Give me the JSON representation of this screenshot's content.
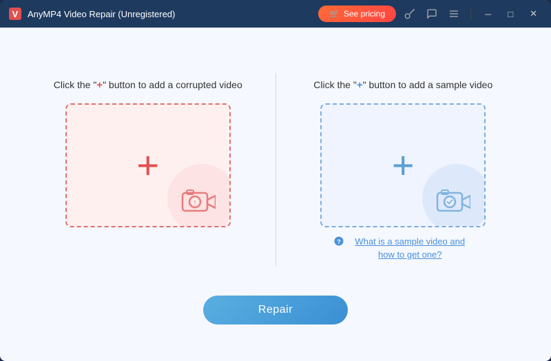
{
  "titlebar": {
    "logo_alt": "AnyMP4 logo",
    "title": "AnyMP4 Video Repair (Unregistered)",
    "see_pricing_label": "See pricing",
    "icon_key": "🛒",
    "window_controls": {
      "minimize": "─",
      "maximize": "□",
      "close": "✕"
    }
  },
  "left_panel": {
    "label_prefix": "Click the \"",
    "plus_char": "+",
    "label_suffix": "\" button to add a corrupted video",
    "box_alt": "Add corrupted video",
    "plus_symbol": "+"
  },
  "right_panel": {
    "label_prefix": "Click the \"",
    "plus_char": "+",
    "label_suffix": "\" button to add a sample video",
    "box_alt": "Add sample video",
    "plus_symbol": "+",
    "help_text": "What is a sample video and how to get one?"
  },
  "footer": {
    "repair_label": "Repair"
  },
  "icons": {
    "key_icon": "🔑",
    "chat_icon": "💬",
    "menu_icon": "≡",
    "question_icon": "?"
  }
}
